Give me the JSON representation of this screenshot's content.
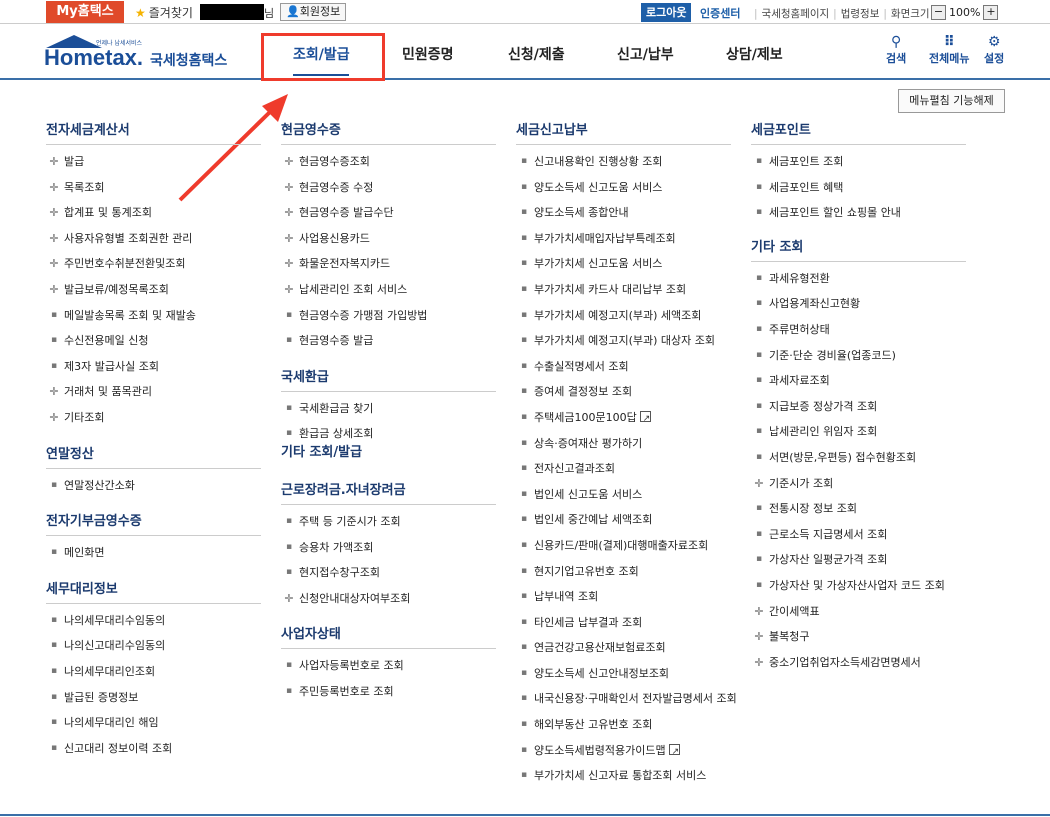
{
  "topbar": {
    "mytax": "My홈택스",
    "fav": "즐겨찾기",
    "nim": "님",
    "member": "회원정보",
    "logout": "로그아웃",
    "cert": "인증센터",
    "links": [
      "국세청홈페이지",
      "법령정보",
      "화면크기"
    ],
    "zoom": "100%"
  },
  "header": {
    "logo_main": "Hometax.",
    "logo_tiny": "언제나 납세서비스",
    "logo_ko": "국세청홈택스",
    "gnb": [
      "조회/발급",
      "민원증명",
      "신청/제출",
      "신고/납부",
      "상담/제보"
    ],
    "right": [
      "검색",
      "전체메뉴",
      "설정"
    ]
  },
  "collapse_button": "메뉴펼침 기능해제",
  "columns": [
    {
      "sections": [
        {
          "title": "전자세금계산서",
          "items": [
            {
              "l": "발급",
              "m": "+"
            },
            {
              "l": "목록조회",
              "m": "+"
            },
            {
              "l": "합계표 및 통계조회",
              "m": "+"
            },
            {
              "l": "사용자유형별 조회권한 관리",
              "m": "+"
            },
            {
              "l": "주민번호수취분전환및조회",
              "m": "+"
            },
            {
              "l": "발급보류/예정목록조회",
              "m": "+"
            },
            {
              "l": "메일발송목록 조회 및 재발송",
              "m": "."
            },
            {
              "l": "수신전용메일 신청",
              "m": "."
            },
            {
              "l": "제3자 발급사실 조회",
              "m": "."
            },
            {
              "l": "거래처 및 품목관리",
              "m": "+"
            },
            {
              "l": "기타조회",
              "m": "+"
            }
          ]
        },
        {
          "title": "연말정산",
          "items": [
            {
              "l": "연말정산간소화",
              "m": "."
            }
          ]
        },
        {
          "title": "전자기부금영수증",
          "items": [
            {
              "l": "메인화면",
              "m": "."
            }
          ]
        },
        {
          "title": "세무대리정보",
          "items": [
            {
              "l": "나의세무대리수임동의",
              "m": "."
            },
            {
              "l": "나의신고대리수임동의",
              "m": "."
            },
            {
              "l": "나의세무대리인조회",
              "m": "."
            },
            {
              "l": "발급된 증명정보",
              "m": "."
            },
            {
              "l": "나의세무대리인 해임",
              "m": "."
            },
            {
              "l": "신고대리 정보이력 조회",
              "m": "."
            }
          ]
        }
      ]
    },
    {
      "sections": [
        {
          "title": "현금영수증",
          "items": [
            {
              "l": "현금영수증조회",
              "m": "+"
            },
            {
              "l": "현금영수증 수정",
              "m": "+"
            },
            {
              "l": "현금영수증 발급수단",
              "m": "+"
            },
            {
              "l": "사업용신용카드",
              "m": "+"
            },
            {
              "l": "화물운전자복지카드",
              "m": "+"
            },
            {
              "l": "납세관리인 조회 서비스",
              "m": "+"
            },
            {
              "l": "현금영수증 가맹점 가입방법",
              "m": "."
            },
            {
              "l": "현금영수증 발급",
              "m": "."
            }
          ]
        },
        {
          "title": "국세환급",
          "items": [
            {
              "l": "국세환급금 찾기",
              "m": "."
            },
            {
              "l": "환급금 상세조회",
              "m": "."
            }
          ]
        },
        {
          "title": "기타 조회/발급",
          "items": []
        },
        {
          "title": "근로장려금.자녀장려금",
          "items": [
            {
              "l": "주택 등 기준시가 조회",
              "m": "."
            },
            {
              "l": "승용차 가액조회",
              "m": "."
            },
            {
              "l": "현지접수창구조회",
              "m": "."
            },
            {
              "l": "신청안내대상자여부조회",
              "m": "+"
            }
          ]
        },
        {
          "title": "사업자상태",
          "items": [
            {
              "l": "사업자등록번호로 조회",
              "m": "."
            },
            {
              "l": "주민등록번호로 조회",
              "m": "."
            }
          ]
        }
      ]
    },
    {
      "sections": [
        {
          "title": "세금신고납부",
          "items": [
            {
              "l": "신고내용확인 진행상황 조회",
              "m": "."
            },
            {
              "l": "양도소득세 신고도움 서비스",
              "m": "."
            },
            {
              "l": "양도소득세 종합안내",
              "m": "."
            },
            {
              "l": "부가가치세매입자납부특례조회",
              "m": "."
            },
            {
              "l": "부가가치세 신고도움 서비스",
              "m": "."
            },
            {
              "l": "부가가치세 카드사 대리납부 조회",
              "m": "."
            },
            {
              "l": "부가가치세 예정고지(부과) 세액조회",
              "m": "."
            },
            {
              "l": "부가가치세 예정고지(부과) 대상자 조회",
              "m": "."
            },
            {
              "l": "수출실적명세서 조회",
              "m": "."
            },
            {
              "l": "증여세 결정정보 조회",
              "m": "."
            },
            {
              "l": "주택세금100문100답",
              "m": ".",
              "ext": true
            },
            {
              "l": "상속·증여재산 평가하기",
              "m": "."
            },
            {
              "l": "전자신고결과조회",
              "m": "."
            },
            {
              "l": "법인세 신고도움 서비스",
              "m": "."
            },
            {
              "l": "법인세 중간예납 세액조회",
              "m": "."
            },
            {
              "l": "신용카드/판매(결제)대행매출자료조회",
              "m": "."
            },
            {
              "l": "현지기업고유번호 조회",
              "m": "."
            },
            {
              "l": "납부내역 조회",
              "m": "."
            },
            {
              "l": "타인세금 납부결과 조회",
              "m": "."
            },
            {
              "l": "연금건강고용산재보험료조회",
              "m": "."
            },
            {
              "l": "양도소득세 신고안내정보조회",
              "m": "."
            },
            {
              "l": "내국신용장·구매확인서 전자발급명세서 조회",
              "m": "."
            },
            {
              "l": "해외부동산 고유번호 조회",
              "m": "."
            },
            {
              "l": "양도소득세법령적용가이드맵",
              "m": ".",
              "ext": true
            },
            {
              "l": "부가가치세 신고자료 통합조회 서비스",
              "m": "."
            }
          ]
        }
      ]
    },
    {
      "sections": [
        {
          "title": "세금포인트",
          "items": [
            {
              "l": "세금포인트 조회",
              "m": "."
            },
            {
              "l": "세금포인트 혜택",
              "m": "."
            },
            {
              "l": "세금포인트 할인 쇼핑몰 안내",
              "m": "."
            }
          ]
        },
        {
          "title": "기타 조회",
          "items": [
            {
              "l": "과세유형전환",
              "m": "."
            },
            {
              "l": "사업용계좌신고현황",
              "m": "."
            },
            {
              "l": "주류면허상태",
              "m": "."
            },
            {
              "l": "기준·단순 경비율(업종코드)",
              "m": "."
            },
            {
              "l": "과세자료조회",
              "m": "."
            },
            {
              "l": "지급보증 정상가격 조회",
              "m": "."
            },
            {
              "l": "납세관리인 위임자 조회",
              "m": "."
            },
            {
              "l": "서면(방문,우편등) 접수현황조회",
              "m": "."
            },
            {
              "l": "기준시가 조회",
              "m": "+"
            },
            {
              "l": "전통시장 정보 조회",
              "m": "."
            },
            {
              "l": "근로소득 지급명세서 조회",
              "m": "."
            },
            {
              "l": "가상자산 일평균가격 조회",
              "m": "."
            },
            {
              "l": "가상자산 및 가상자산사업자 코드 조회",
              "m": "."
            },
            {
              "l": "간이세액표",
              "m": "+"
            },
            {
              "l": "불복청구",
              "m": "+"
            },
            {
              "l": "중소기업취업자소득세감면명세서",
              "m": "+"
            }
          ]
        }
      ]
    }
  ]
}
